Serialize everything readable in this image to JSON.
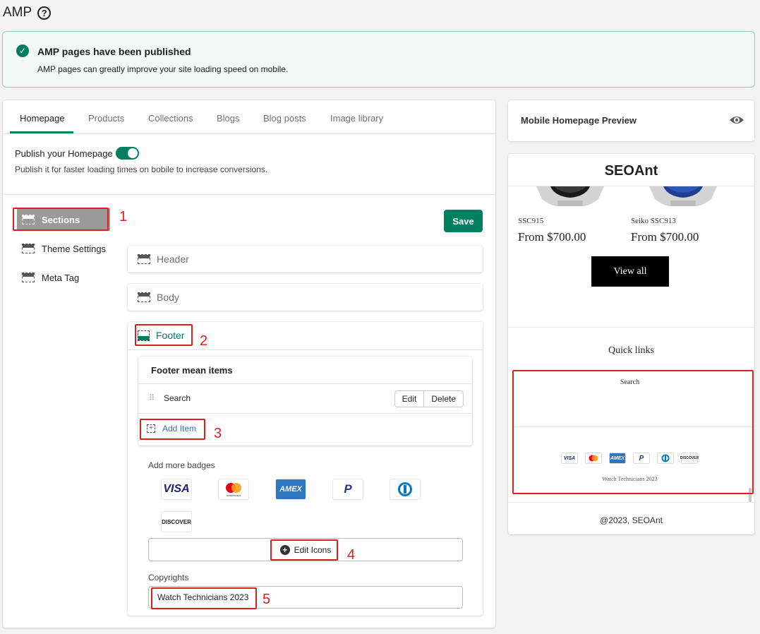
{
  "header": {
    "title": "AMP",
    "help_icon": "question-circle-icon"
  },
  "banner": {
    "title": "AMP pages have been published",
    "text": "AMP pages can greatly improve your site loading speed on mobile.",
    "icon": "check-circle-icon",
    "color": "#007f5f"
  },
  "tabs": [
    {
      "label": "Homepage"
    },
    {
      "label": "Products"
    },
    {
      "label": "Collections"
    },
    {
      "label": "Blogs"
    },
    {
      "label": "Blog posts"
    },
    {
      "label": "Image library"
    }
  ],
  "publish": {
    "label": "Publish your Homepage",
    "enabled": true,
    "description": "Publish it for faster loading times on bobile to increase conversions."
  },
  "sidebar": {
    "items": [
      {
        "label": "Sections",
        "active": true
      },
      {
        "label": "Theme Settings"
      },
      {
        "label": "Meta Tag"
      }
    ]
  },
  "toolbar": {
    "save_label": "Save"
  },
  "sections": {
    "header_label": "Header",
    "body_label": "Body",
    "footer_label": "Footer"
  },
  "footer_menu": {
    "title": "Footer mean items",
    "items": [
      {
        "label": "Search"
      }
    ],
    "edit_label": "Edit",
    "delete_label": "Delete",
    "add_item_label": "Add Item"
  },
  "badges": {
    "label": "Add more badges",
    "items": [
      "VISA",
      "mastercard",
      "AMEX",
      "PayPal",
      "Diners Club",
      "DISCOVER"
    ],
    "edit_icons_label": "Edit Icons"
  },
  "copyrights": {
    "label": "Copyrights",
    "value": "Watch Technicians 2023"
  },
  "annotations": [
    "1",
    "2",
    "3",
    "4",
    "5"
  ],
  "preview": {
    "title": "Mobile Homepage Preview",
    "eye_icon": "eye-icon",
    "store_name": "SEOAnt",
    "products": [
      {
        "name": "SSC915",
        "price": "From $700.00"
      },
      {
        "name": "Seiko SSC913",
        "price": "From $700.00"
      }
    ],
    "view_all": "View all",
    "quick_links": "Quick links",
    "footer_link": "Search",
    "footer_copyright": "Watch Technicians 2023",
    "bottom_text": "@2023, SEOAnt"
  },
  "colors": {
    "accent": "#008060",
    "annotation": "#e02020"
  }
}
